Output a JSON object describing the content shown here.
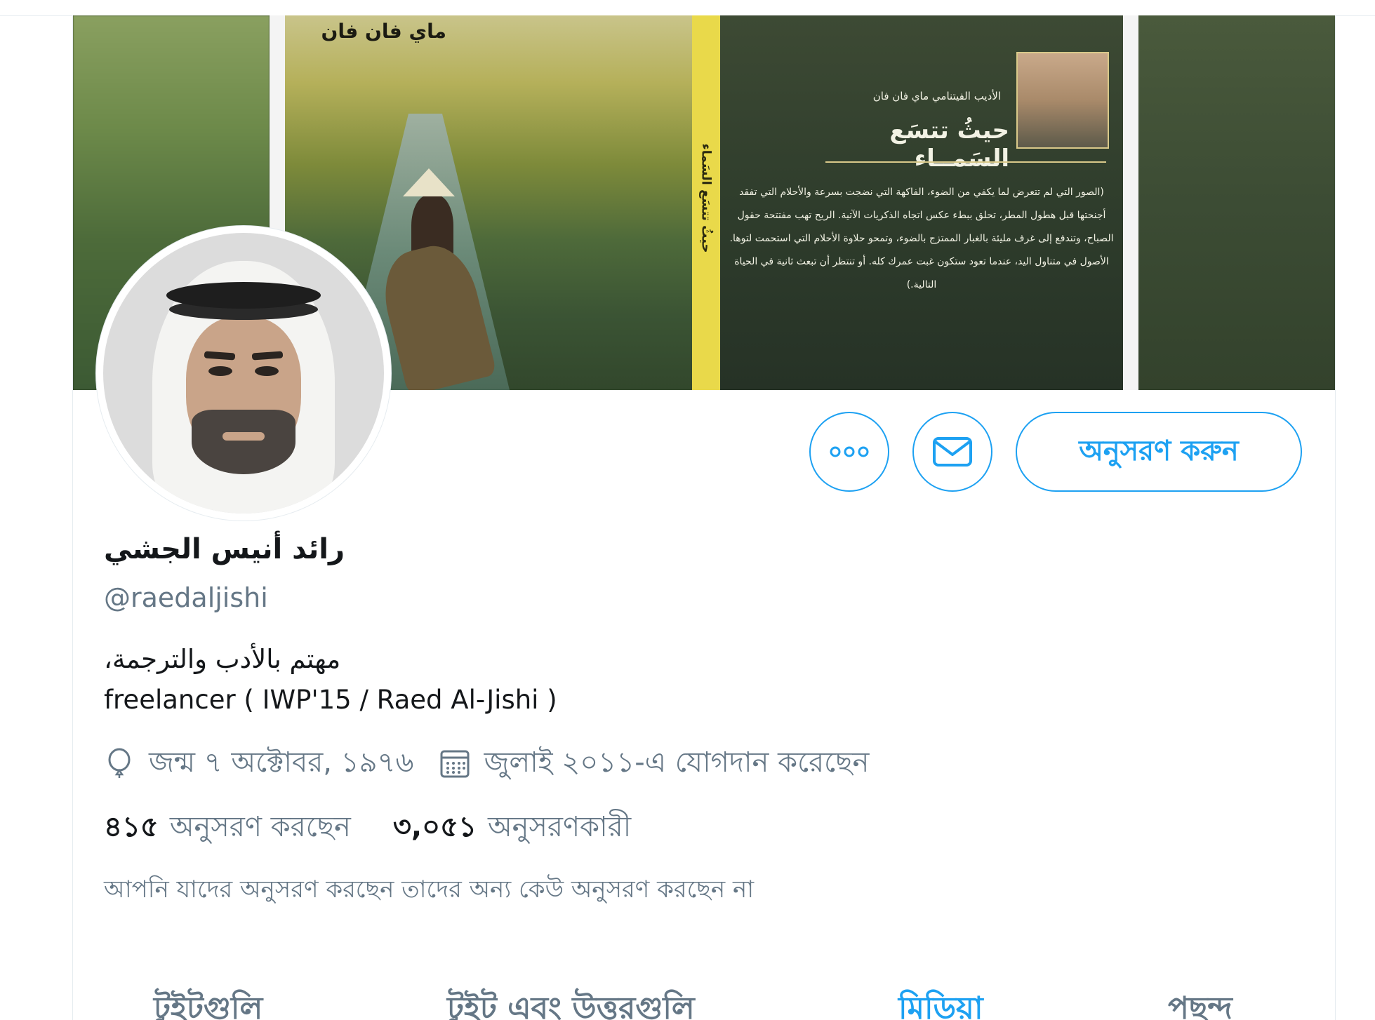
{
  "profile": {
    "display_name": "رائد أنيس الجشي",
    "handle": "@raedaljishi",
    "bio_line1": "مهتم بالأدب والترجمة،",
    "bio_line2": "freelancer ( IWP'15 / Raed Al-Jishi )",
    "birth": "জন্ম ৭ অক্টোবর, ১৯৭৬",
    "joined": "জুলাই ২০১১-এ যোগদান করেছেন",
    "following_count": "৪১৫",
    "following_label": "অনুসরণ করছেন",
    "followers_count": "৩,০৫১",
    "followers_label": "অনুসরণকারী",
    "mutual_note": "আপনি যাদের অনুসরণ করছেন তাদের অন্য কেউ অনুসরণ করছেন না"
  },
  "actions": {
    "more_icon": "more-icon",
    "message_icon": "envelope-icon",
    "follow_label": "অনুসরণ করুন"
  },
  "banner": {
    "cover_title_top": "ماي فان فان",
    "spine_text": "حيثُ تتسَع السَماء",
    "author_small": "الأديب الفيتنامي ماي فان فان",
    "book_title": "حيثُ تتسَع السَمــاء",
    "quote": "(الصور التي لم تتعرض لما يكفي من الضوء، الفاكهة التي نضجت بسرعة والأحلام التي تفقد أجنحتها قبل هطول المطر، تحلق ببطء عكس اتجاه الذكريات الآتية. الريح تهب مفتتحة حقول الصباح، وتندفع إلى غرف مليئة بالغبار الممتزج بالضوء، وتمحو حلاوة الأحلام التي استحمت لتوها. الأصول في متناول اليد، عندما تعود ستكون غبت عمرك كله. أو تنتظر أن تبعث ثانية في الحياة التالية.)"
  },
  "tabs": [
    {
      "label": "টুইটগুলি",
      "active": false
    },
    {
      "label": "টুইট এবং উত্তরগুলি",
      "active": false
    },
    {
      "label": "মিডিয়া",
      "active": true
    },
    {
      "label": "পছন্দ",
      "active": false
    }
  ],
  "colors": {
    "accent": "#1da1f2",
    "text_primary": "#14171a",
    "text_secondary": "#657786",
    "border": "#e6ecf0"
  }
}
